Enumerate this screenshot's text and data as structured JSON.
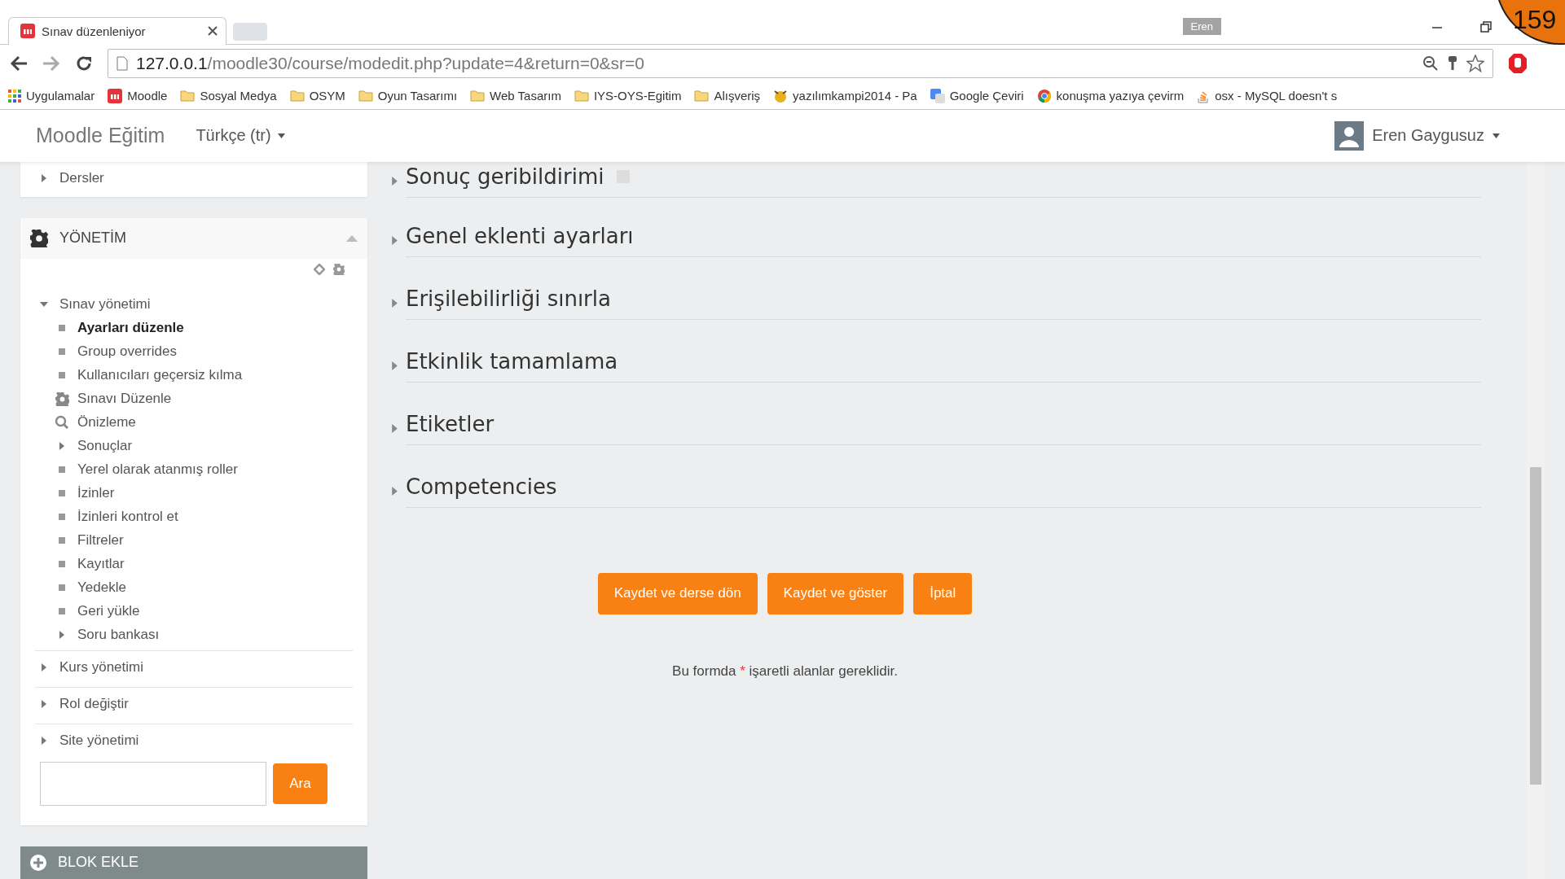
{
  "browser": {
    "tab_title": "Sınav düzenleniyor",
    "profile": "Eren",
    "address": {
      "host": "127.0.0.1",
      "path": "/moodle30/course/modedit.php?update=4&return=0&sr=0"
    },
    "bookmarks": [
      {
        "kind": "apps",
        "label": "Uygulamalar"
      },
      {
        "kind": "moodle",
        "label": "Moodle"
      },
      {
        "kind": "folder",
        "label": "Sosyal Medya"
      },
      {
        "kind": "folder",
        "label": "OSYM"
      },
      {
        "kind": "folder",
        "label": "Oyun Tasarımı"
      },
      {
        "kind": "folder",
        "label": "Web Tasarım"
      },
      {
        "kind": "folder",
        "label": "IYS-OYS-Egitim"
      },
      {
        "kind": "folder",
        "label": "Alışveriş"
      },
      {
        "kind": "leopard",
        "label": "yazılımkampi2014 - Pa"
      },
      {
        "kind": "translate",
        "label": "Google Çeviri"
      },
      {
        "kind": "chrome",
        "label": "konuşma yazıya çevirm"
      },
      {
        "kind": "stack",
        "label": "osx - MySQL doesn't s"
      }
    ]
  },
  "overlay_badge": "159",
  "navbar": {
    "brand": "Moodle Eğitim",
    "language": "Türkçe (tr)",
    "user": "Eren Gaygusuz"
  },
  "sidebar": {
    "courses_item": "Dersler",
    "admin_block": {
      "title": "YÖNETİM",
      "expanded": true,
      "tree": [
        {
          "label": "Sınav yönetimi",
          "kind": "branch",
          "expanded": true,
          "children": [
            {
              "label": "Ayarları düzenle",
              "kind": "leaf",
              "selected": true
            },
            {
              "label": "Group overrides",
              "kind": "leaf",
              "selected": false
            },
            {
              "label": "Kullanıcıları geçersiz kılma",
              "kind": "leaf",
              "selected": false
            },
            {
              "label": "Sınavı Düzenle",
              "kind": "gear",
              "selected": false
            },
            {
              "label": "Önizleme",
              "kind": "search",
              "selected": false
            },
            {
              "label": "Sonuçlar",
              "kind": "branch",
              "expanded": false
            },
            {
              "label": "Yerel olarak atanmış roller",
              "kind": "leaf",
              "selected": false
            },
            {
              "label": "İzinler",
              "kind": "leaf",
              "selected": false
            },
            {
              "label": "İzinleri kontrol et",
              "kind": "leaf",
              "selected": false
            },
            {
              "label": "Filtreler",
              "kind": "leaf",
              "selected": false
            },
            {
              "label": "Kayıtlar",
              "kind": "leaf",
              "selected": false
            },
            {
              "label": "Yedekle",
              "kind": "leaf",
              "selected": false
            },
            {
              "label": "Geri yükle",
              "kind": "leaf",
              "selected": false
            },
            {
              "label": "Soru bankası",
              "kind": "branch",
              "expanded": false
            }
          ]
        },
        {
          "label": "Kurs yönetimi",
          "kind": "branch",
          "expanded": false
        },
        {
          "label": "Rol değiştir",
          "kind": "branch",
          "expanded": false
        },
        {
          "label": "Site yönetimi",
          "kind": "branch",
          "expanded": false
        }
      ],
      "search_button": "Ara"
    },
    "add_block": "BLOK EKLE"
  },
  "form": {
    "sections": [
      {
        "title": "Sonuç geribildirimi",
        "expanded": false,
        "help": true
      },
      {
        "title": "Genel eklenti ayarları",
        "expanded": false,
        "help": false
      },
      {
        "title": "Erişilebilirliği sınırla",
        "expanded": false,
        "help": false
      },
      {
        "title": "Etkinlik tamamlama",
        "expanded": false,
        "help": false
      },
      {
        "title": "Etiketler",
        "expanded": false,
        "help": false
      },
      {
        "title": "Competencies",
        "expanded": false,
        "help": false
      }
    ],
    "buttons": [
      "Kaydet ve derse dön",
      "Kaydet ve göster",
      "İptal"
    ],
    "required_note": {
      "before": "Bu formda",
      "marker": "*",
      "after": "işaretli alanlar gereklidir."
    }
  }
}
